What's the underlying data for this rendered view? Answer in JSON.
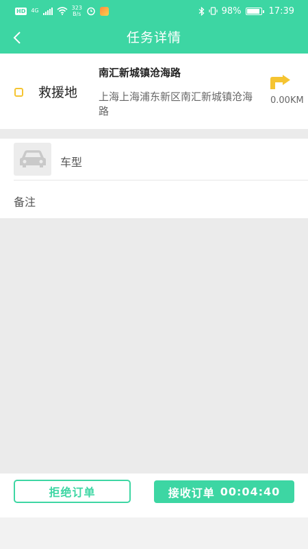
{
  "colors": {
    "accent": "#3dd6a3",
    "marker": "#f5c431",
    "background": "#ebebeb"
  },
  "status_bar": {
    "badge": "HD",
    "network": "4G",
    "speed_value": "323",
    "speed_unit": "B/s",
    "battery": "98%",
    "time": "17:39",
    "icons": [
      "hd-icon",
      "signal-icon",
      "wifi-icon",
      "alarm-icon",
      "app-notification-icon",
      "bluetooth-icon",
      "vibrate-icon",
      "battery-icon"
    ]
  },
  "header": {
    "back_icon": "chevron-left-icon",
    "title": "任务详情"
  },
  "address": {
    "type": "救援地",
    "name": "南汇新城镇沧海路",
    "detail": "上海上海浦东新区南汇新城镇沧海路",
    "distance": "0.00KM",
    "nav_icon": "turn-navigation-icon"
  },
  "vehicle": {
    "icon": "car-icon",
    "label": "车型"
  },
  "note": {
    "label": "备注"
  },
  "actions": {
    "reject_label": "拒绝订单",
    "accept_label": "接收订单",
    "countdown": "00:04:40"
  }
}
